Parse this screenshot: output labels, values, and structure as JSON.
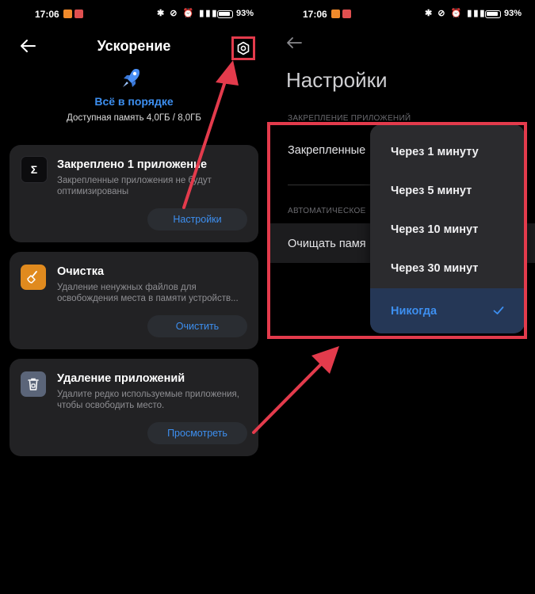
{
  "status_bar": {
    "time": "17:06",
    "battery": "93"
  },
  "left": {
    "title": "Ускорение",
    "status": "Всё в порядке",
    "memory": "Доступная память 4,0ГБ / 8,0ГБ",
    "cards": [
      {
        "title": "Закреплено 1 приложение",
        "desc": "Закрепленные приложения не будут оптимизированы",
        "button": "Настройки"
      },
      {
        "title": "Очистка",
        "desc": "Удаление ненужных файлов для освобождения места в памяти устройств...",
        "button": "Очистить"
      },
      {
        "title": "Удаление приложений",
        "desc": "Удалите редко используемые приложения, чтобы освободить место.",
        "button": "Просмотреть"
      }
    ]
  },
  "right": {
    "title": "Настройки",
    "section1": "ЗАКРЕПЛЕНИЕ ПРИЛОЖЕНИЙ",
    "row1": "Закрепленные",
    "section2": "АВТОМАТИЧЕСКОЕ",
    "row2": "Очищать памя",
    "options": [
      "Через 1 минуту",
      "Через 5 минут",
      "Через 10 минут",
      "Через 30 минут",
      "Никогда"
    ],
    "selected_option": "Никогда"
  },
  "colors": {
    "accent": "#3d8ff0",
    "annotation_red": "#e33b4c",
    "card_bg": "#222224"
  }
}
